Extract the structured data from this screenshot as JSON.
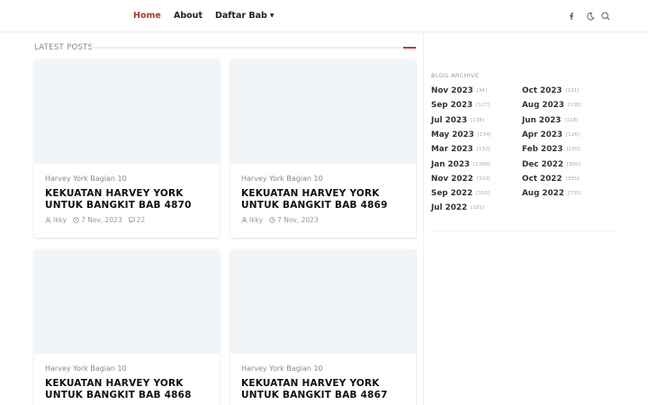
{
  "nav": {
    "home": "Home",
    "about": "About",
    "bab": "Daftar Bab"
  },
  "icons": [
    "facebook-icon",
    "moon-icon",
    "search-icon"
  ],
  "section": {
    "title": "LATEST POSTS"
  },
  "accent_color": "#c0392b",
  "posts": [
    {
      "category": "Harvey York Bagian 10",
      "title_line1": "KEKUATAN HARVEY YORK",
      "title_line2": "UNTUK BANGKIT BAB 4870",
      "author": "Ikky",
      "date": "7 Nov, 2023",
      "comments": "22"
    },
    {
      "category": "Harvey York Bagian 10",
      "title_line1": "KEKUATAN HARVEY YORK",
      "title_line2": "UNTUK BANGKIT BAB 4869",
      "author": "Ikky",
      "date": "7 Nov, 2023",
      "comments": ""
    },
    {
      "category": "Harvey York Bagian 10",
      "title_line1": "KEKUATAN HARVEY YORK",
      "title_line2": "UNTUK BANGKIT BAB 4868"
    },
    {
      "category": "Harvey York Bagian 10",
      "title_line1": "KEKUATAN HARVEY YORK",
      "title_line2": "UNTUK BANGKIT BAB 4867"
    }
  ],
  "sidebar": {
    "title": "BLOG ARCHIVE",
    "archive": [
      {
        "label": "Nov 2023",
        "count": "[34]"
      },
      {
        "label": "Oct 2023",
        "count": "[131]"
      },
      {
        "label": "Sep 2023",
        "count": "[127]"
      },
      {
        "label": "Aug 2023",
        "count": "[138]"
      },
      {
        "label": "Jul 2023",
        "count": "[138]"
      },
      {
        "label": "Jun 2023",
        "count": "[118]"
      },
      {
        "label": "May 2023",
        "count": "[134]"
      },
      {
        "label": "Apr 2023",
        "count": "[126]"
      },
      {
        "label": "Mar 2023",
        "count": "[132]"
      },
      {
        "label": "Feb 2023",
        "count": "[230]"
      },
      {
        "label": "Jan 2023",
        "count": "[1390]"
      },
      {
        "label": "Dec 2022",
        "count": "[350]"
      },
      {
        "label": "Nov 2022",
        "count": "[310]"
      },
      {
        "label": "Oct 2022",
        "count": "[335]"
      },
      {
        "label": "Sep 2022",
        "count": "[350]"
      },
      {
        "label": "Aug 2022",
        "count": "[735]"
      },
      {
        "label": "Jul 2022",
        "count": "[181]"
      }
    ]
  }
}
